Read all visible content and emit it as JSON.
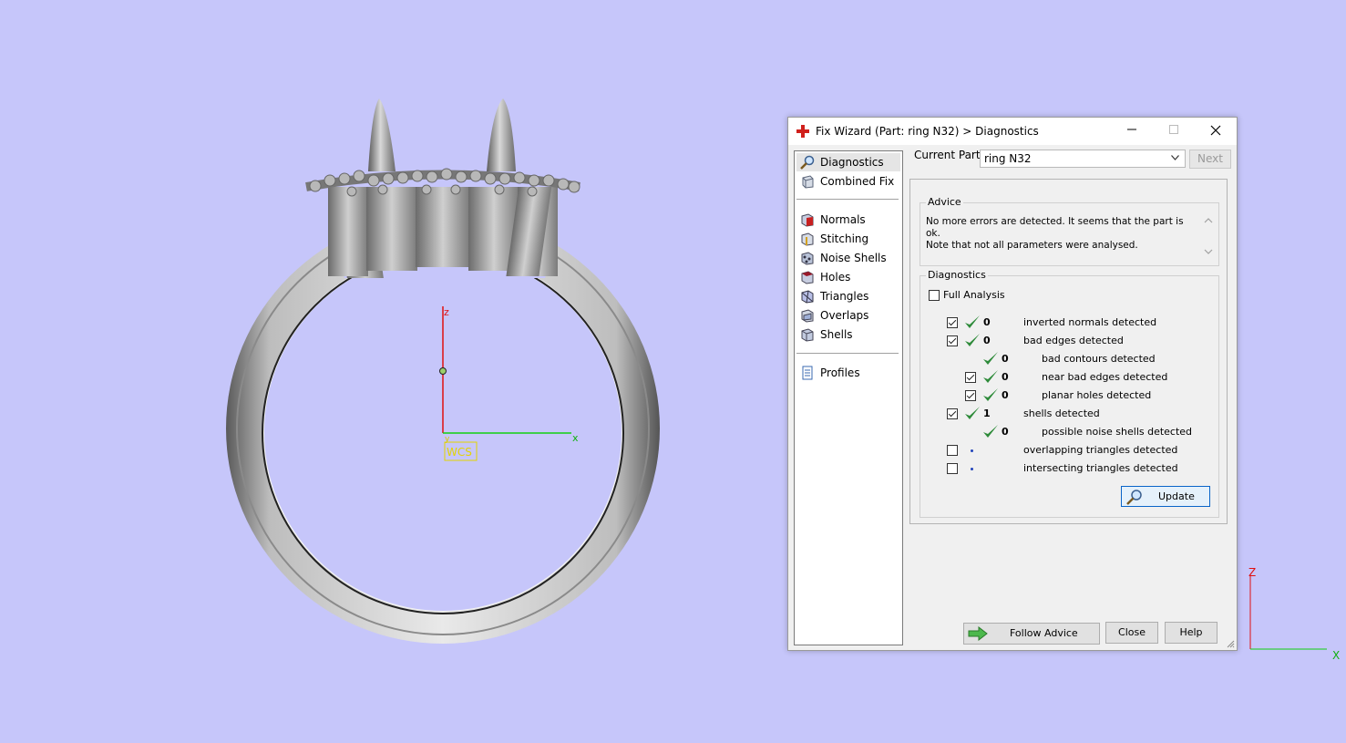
{
  "viewport": {
    "wcs_label": "WCS",
    "axis_z": "z",
    "axis_x": "x",
    "axis_y": "y",
    "corner_axis_z": "Z",
    "corner_axis_x": "X",
    "background_color": "#c6c6fa"
  },
  "dialog": {
    "title": "Fix Wizard (Part: ring N32) > Diagnostics",
    "window_controls": [
      "minimize",
      "maximize",
      "close"
    ],
    "current_part_label": "Current Part:",
    "current_part_value": "ring N32",
    "next_label": "Next",
    "nav": {
      "items_top": [
        {
          "label": "Diagnostics",
          "icon": "magnifier-icon",
          "selected": true
        },
        {
          "label": "Combined Fix",
          "icon": "combined-fix-icon",
          "selected": false
        }
      ],
      "items_mid": [
        {
          "label": "Normals",
          "icon": "normals-cube-icon"
        },
        {
          "label": "Stitching",
          "icon": "stitching-cube-icon"
        },
        {
          "label": "Noise Shells",
          "icon": "noise-shells-icon"
        },
        {
          "label": "Holes",
          "icon": "holes-cube-icon"
        },
        {
          "label": "Triangles",
          "icon": "triangles-cube-icon"
        },
        {
          "label": "Overlaps",
          "icon": "overlaps-cube-icon"
        },
        {
          "label": "Shells",
          "icon": "shells-cube-icon"
        }
      ],
      "items_bottom": [
        {
          "label": "Profiles",
          "icon": "profiles-document-icon"
        }
      ]
    },
    "advice": {
      "title": "Advice",
      "line1": "No more errors are detected. It seems that the part is ok.",
      "line2": "Note that not all parameters were analysed."
    },
    "diagnostics": {
      "title": "Diagnostics",
      "full_analysis_label": "Full Analysis",
      "full_analysis_checked": false,
      "rows": [
        {
          "checkbox": true,
          "checked": true,
          "status": "ok",
          "count": "0",
          "label": "inverted normals detected",
          "indent": 0
        },
        {
          "checkbox": true,
          "checked": true,
          "status": "ok",
          "count": "0",
          "label": "bad edges detected",
          "indent": 0
        },
        {
          "checkbox": false,
          "checked": false,
          "status": "ok",
          "count": "0",
          "label": "bad contours detected",
          "indent": 1
        },
        {
          "checkbox": true,
          "checked": true,
          "status": "ok",
          "count": "0",
          "label": "near bad edges detected",
          "indent": 1
        },
        {
          "checkbox": true,
          "checked": true,
          "status": "ok",
          "count": "0",
          "label": "planar holes detected",
          "indent": 1
        },
        {
          "checkbox": true,
          "checked": true,
          "status": "ok",
          "count": "1",
          "label": "shells detected",
          "indent": 0
        },
        {
          "checkbox": false,
          "checked": false,
          "status": "ok",
          "count": "0",
          "label": "possible noise shells detected",
          "indent": 1
        },
        {
          "checkbox": true,
          "checked": false,
          "status": "pending",
          "count": "",
          "label": "overlapping triangles detected",
          "indent": 0
        },
        {
          "checkbox": true,
          "checked": false,
          "status": "pending",
          "count": "",
          "label": "intersecting triangles detected",
          "indent": 0
        }
      ],
      "update_label": "Update"
    },
    "buttons": {
      "follow_advice": "Follow Advice",
      "close": "Close",
      "help": "Help"
    },
    "colors": {
      "ok_tick": "#2e8b3a",
      "accent_border": "#0a64c8",
      "title_icon": "#d0201c"
    }
  }
}
